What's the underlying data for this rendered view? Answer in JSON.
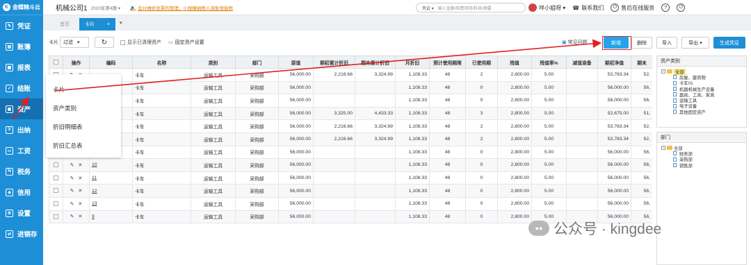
{
  "app": {
    "logo": "金蝶精斗云",
    "logo_mark": "K"
  },
  "sidebar": {
    "items": [
      {
        "label": "凭证",
        "icon": "voucher-icon",
        "glyph": "✎"
      },
      {
        "label": "账簿",
        "icon": "ledger-icon",
        "glyph": "▤"
      },
      {
        "label": "报表",
        "icon": "report-icon",
        "glyph": "▦"
      },
      {
        "label": "结账",
        "icon": "checkout-icon",
        "glyph": "✓"
      },
      {
        "label": "资产",
        "icon": "asset-icon",
        "glyph": "▣"
      },
      {
        "label": "出纳",
        "icon": "cashier-icon",
        "glyph": "¥"
      },
      {
        "label": "工资",
        "icon": "salary-icon",
        "glyph": "▭"
      },
      {
        "label": "税务",
        "icon": "tax-icon",
        "glyph": "%"
      },
      {
        "label": "信用",
        "icon": "credit-icon",
        "glyph": "◈"
      },
      {
        "label": "设置",
        "icon": "settings-icon",
        "glyph": "⚙"
      },
      {
        "label": "进销存",
        "icon": "inventory-icon",
        "glyph": "⇄"
      }
    ],
    "active_index": 4
  },
  "topbar": {
    "company": "机械公司1",
    "period": "2020年第4期 ▾",
    "notice": "会计做好发票的管理，小规模纳税人减免增值税",
    "voucher_type": "凭证 ▾",
    "search_placeholder": "输入金额/核算项目/科目/摘要",
    "user": "咩小姐呀 ▾",
    "contact": "联系我们",
    "service": "售后在线服务"
  },
  "tabs": {
    "home": "首页",
    "active": "卡片",
    "close": "×",
    "caret": "▾"
  },
  "toolbar": {
    "card_label": "卡片",
    "filter_value": "过滤",
    "refresh": "↻",
    "show_cleared": "显示已清理资产",
    "fixed_asset_settings": "固定资产设置",
    "faq": "常见问题",
    "new": "新增",
    "delete": "删除",
    "import": "导入",
    "export": "导出 ▾",
    "gen_voucher": "生成凭证"
  },
  "table": {
    "headers": [
      "",
      "操作",
      "编码",
      "名称",
      "类别",
      "部门",
      "原值",
      "期初累计折旧",
      "期末累计折旧",
      "月折旧",
      "预计使用期限",
      "已使用期",
      "残值",
      "残值率%",
      "减值准备",
      "期初净值",
      "期末"
    ],
    "rows": [
      {
        "code": "",
        "name": "卡车",
        "category": "运输工具",
        "dept": "采购部",
        "orig": "56,000.00",
        "open_dep": "2,216.66",
        "close_dep": "3,324.99",
        "monthly": "1,108.33",
        "life": "48",
        "used": "2",
        "salvage": "2,800.00",
        "rate": "5.00",
        "impair": "",
        "open_net": "53,783.34",
        "end": "52,"
      },
      {
        "code": "",
        "name": "卡车",
        "category": "运输工具",
        "dept": "采购部",
        "orig": "56,000.00",
        "open_dep": "",
        "close_dep": "",
        "monthly": "1,108.33",
        "life": "48",
        "used": "0",
        "salvage": "2,800.00",
        "rate": "5.00",
        "impair": "",
        "open_net": "56,000.00",
        "end": "56,"
      },
      {
        "code": "",
        "name": "卡车",
        "category": "运输工具",
        "dept": "采购部",
        "orig": "56,000.00",
        "open_dep": "",
        "close_dep": "",
        "monthly": "1,108.33",
        "life": "48",
        "used": "0",
        "salvage": "2,800.00",
        "rate": "5.00",
        "impair": "",
        "open_net": "56,000.00",
        "end": "56,"
      },
      {
        "code": "",
        "name": "卡车",
        "category": "运输工具",
        "dept": "采购部",
        "orig": "56,000.00",
        "open_dep": "3,325.00",
        "close_dep": "4,433.33",
        "monthly": "1,108.33",
        "life": "48",
        "used": "3",
        "salvage": "2,800.00",
        "rate": "5.00",
        "impair": "",
        "open_net": "52,675.00",
        "end": "51,"
      },
      {
        "code": "",
        "name": "卡车",
        "category": "运输工具",
        "dept": "采购部",
        "orig": "56,000.00",
        "open_dep": "2,216.66",
        "close_dep": "3,324.99",
        "monthly": "1,108.33",
        "life": "48",
        "used": "2",
        "salvage": "2,800.00",
        "rate": "5.00",
        "impair": "",
        "open_net": "53,783.34",
        "end": "52,"
      },
      {
        "code": "",
        "name": "卡车",
        "category": "运输工具",
        "dept": "采购部",
        "orig": "56,000.00",
        "open_dep": "2,216.66",
        "close_dep": "3,324.99",
        "monthly": "1,108.33",
        "life": "48",
        "used": "2",
        "salvage": "2,800.00",
        "rate": "5.00",
        "impair": "",
        "open_net": "53,783.34",
        "end": "52,"
      },
      {
        "code": "",
        "name": "卡车",
        "category": "运输工具",
        "dept": "采购部",
        "orig": "56,000.00",
        "open_dep": "",
        "close_dep": "",
        "monthly": "1,108.33",
        "life": "48",
        "used": "0",
        "salvage": "2,800.00",
        "rate": "5.00",
        "impair": "",
        "open_net": "56,000.00",
        "end": "56,"
      },
      {
        "code": "10",
        "name": "卡车",
        "category": "运输工具",
        "dept": "采购部",
        "orig": "56,000.00",
        "open_dep": "",
        "close_dep": "",
        "monthly": "1,108.33",
        "life": "48",
        "used": "0",
        "salvage": "2,800.00",
        "rate": "5.00",
        "impair": "",
        "open_net": "56,000.00",
        "end": "56,"
      },
      {
        "code": "11",
        "name": "卡车",
        "category": "运输工具",
        "dept": "采购部",
        "orig": "56,000.00",
        "open_dep": "",
        "close_dep": "",
        "monthly": "1,108.33",
        "life": "48",
        "used": "0",
        "salvage": "2,800.00",
        "rate": "5.00",
        "impair": "",
        "open_net": "56,000.00",
        "end": "56,"
      },
      {
        "code": "12",
        "name": "卡车",
        "category": "运输工具",
        "dept": "采购部",
        "orig": "56,000.00",
        "open_dep": "",
        "close_dep": "",
        "monthly": "1,108.33",
        "life": "48",
        "used": "0",
        "salvage": "2,800.00",
        "rate": "5.00",
        "impair": "",
        "open_net": "56,000.00",
        "end": "56,"
      },
      {
        "code": "13",
        "name": "卡车",
        "category": "运输工具",
        "dept": "采购部",
        "orig": "56,000.00",
        "open_dep": "",
        "close_dep": "",
        "monthly": "1,108.33",
        "life": "48",
        "used": "0",
        "salvage": "2,800.00",
        "rate": "5.00",
        "impair": "",
        "open_net": "56,000.00",
        "end": "56,"
      },
      {
        "code": "9",
        "name": "卡车",
        "category": "运输工具",
        "dept": "采购部",
        "orig": "56,000.00",
        "open_dep": "",
        "close_dep": "",
        "monthly": "1,108.33",
        "life": "48",
        "used": "0",
        "salvage": "2,800.00",
        "rate": "5.00",
        "impair": "",
        "open_net": "56,000.00",
        "end": "56,"
      }
    ]
  },
  "dropdown": {
    "items": [
      "卡片",
      "资产类别",
      "折旧明细表",
      "折旧汇总表"
    ]
  },
  "asset_tree": {
    "title": "资产类别",
    "root": "全部",
    "children": [
      "房屋、建筑物",
      "卡车01",
      "机器机械生产设备",
      "器具、工具、家具",
      "运输工具",
      "电子设备",
      "其他固定资产"
    ]
  },
  "dept_tree": {
    "title": "部门",
    "root": "全部",
    "children": [
      "财务部",
      "采购部",
      "销售部"
    ]
  },
  "watermark": {
    "text": "公众号 · kingdee",
    "icon_glyph": "●●"
  },
  "colors": {
    "brand": "#1e8fd6",
    "annotation": "#e02020"
  }
}
